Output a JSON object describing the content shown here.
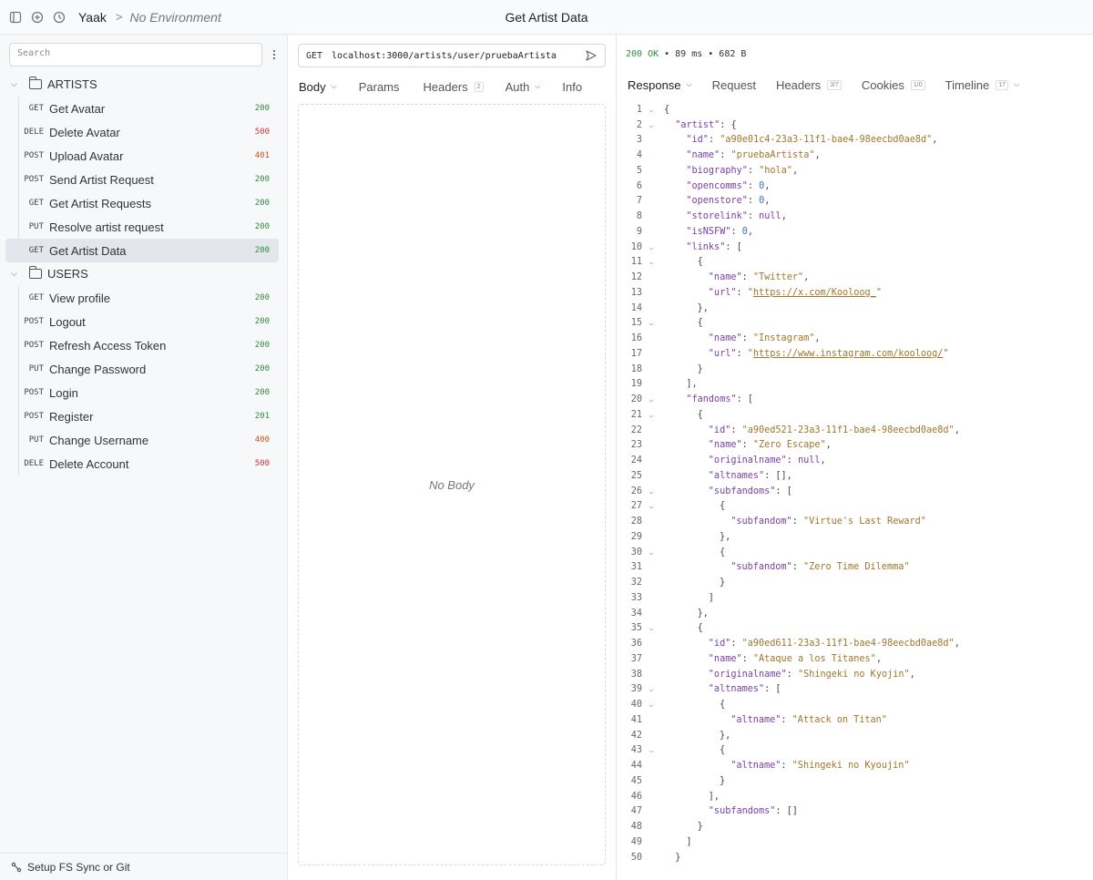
{
  "titlebar": {
    "workspace": "Yaak",
    "separator": ">",
    "environment": "No Environment",
    "window_title": "Get Artist Data"
  },
  "sidebar": {
    "search_placeholder": "Search",
    "folders": [
      {
        "name": "ARTISTS",
        "items": [
          {
            "method": "GET",
            "name": "Get Avatar",
            "status": "200"
          },
          {
            "method": "DELE",
            "name": "Delete Avatar",
            "status": "500"
          },
          {
            "method": "POST",
            "name": "Upload Avatar",
            "status": "401"
          },
          {
            "method": "POST",
            "name": "Send Artist Request",
            "status": "200"
          },
          {
            "method": "GET",
            "name": "Get Artist Requests",
            "status": "200"
          },
          {
            "method": "PUT",
            "name": "Resolve artist request",
            "status": "200"
          },
          {
            "method": "GET",
            "name": "Get Artist Data",
            "status": "200",
            "active": true
          }
        ]
      },
      {
        "name": "USERS",
        "items": [
          {
            "method": "GET",
            "name": "View profile",
            "status": "200"
          },
          {
            "method": "POST",
            "name": "Logout",
            "status": "200"
          },
          {
            "method": "POST",
            "name": "Refresh Access Token",
            "status": "200"
          },
          {
            "method": "PUT",
            "name": "Change Password",
            "status": "200"
          },
          {
            "method": "POST",
            "name": "Login",
            "status": "200"
          },
          {
            "method": "POST",
            "name": "Register",
            "status": "201"
          },
          {
            "method": "PUT",
            "name": "Change Username",
            "status": "400"
          },
          {
            "method": "DELE",
            "name": "Delete Account",
            "status": "500"
          }
        ]
      }
    ],
    "footer": "Setup FS Sync or Git"
  },
  "request": {
    "method": "GET",
    "url": "localhost:3000/artists/user/pruebaArtista",
    "tabs": {
      "body": "Body",
      "params": "Params",
      "headers": "Headers",
      "headers_count": "2",
      "auth": "Auth",
      "info": "Info"
    },
    "empty_body": "No Body"
  },
  "response": {
    "status": "200 OK",
    "time": "89 ms",
    "size": "682 B",
    "bullet": "•",
    "tabs": {
      "response": "Response",
      "request": "Request",
      "headers": "Headers",
      "headers_count": "3/7",
      "cookies": "Cookies",
      "cookies_count": "1/0",
      "timeline": "Timeline",
      "timeline_count": "17"
    },
    "lines": [
      {
        "n": "1",
        "fold": "v",
        "indent": 0,
        "parts": [
          [
            "p",
            "{"
          ]
        ]
      },
      {
        "n": "2",
        "fold": "v",
        "indent": 1,
        "parts": [
          [
            "k",
            "\"artist\""
          ],
          [
            "p",
            ": {"
          ]
        ]
      },
      {
        "n": "3",
        "indent": 2,
        "parts": [
          [
            "k",
            "\"id\""
          ],
          [
            "p",
            ": "
          ],
          [
            "s",
            "\"a90e01c4-23a3-11f1-bae4-98eecbd0ae8d\""
          ],
          [
            "p",
            ","
          ]
        ]
      },
      {
        "n": "4",
        "indent": 2,
        "parts": [
          [
            "k",
            "\"name\""
          ],
          [
            "p",
            ": "
          ],
          [
            "s",
            "\"pruebaArtista\""
          ],
          [
            "p",
            ","
          ]
        ]
      },
      {
        "n": "5",
        "indent": 2,
        "parts": [
          [
            "k",
            "\"biography\""
          ],
          [
            "p",
            ": "
          ],
          [
            "s",
            "\"hola\""
          ],
          [
            "p",
            ","
          ]
        ]
      },
      {
        "n": "6",
        "indent": 2,
        "parts": [
          [
            "k",
            "\"opencomms\""
          ],
          [
            "p",
            ": "
          ],
          [
            "n",
            "0"
          ],
          [
            "p",
            ","
          ]
        ]
      },
      {
        "n": "7",
        "indent": 2,
        "parts": [
          [
            "k",
            "\"openstore\""
          ],
          [
            "p",
            ": "
          ],
          [
            "n",
            "0"
          ],
          [
            "p",
            ","
          ]
        ]
      },
      {
        "n": "8",
        "indent": 2,
        "parts": [
          [
            "k",
            "\"storelink\""
          ],
          [
            "p",
            ": "
          ],
          [
            "k",
            "null"
          ],
          [
            "p",
            ","
          ]
        ]
      },
      {
        "n": "9",
        "indent": 2,
        "parts": [
          [
            "k",
            "\"isNSFW\""
          ],
          [
            "p",
            ": "
          ],
          [
            "n",
            "0"
          ],
          [
            "p",
            ","
          ]
        ]
      },
      {
        "n": "10",
        "fold": "v",
        "indent": 2,
        "parts": [
          [
            "k",
            "\"links\""
          ],
          [
            "p",
            ": ["
          ]
        ]
      },
      {
        "n": "11",
        "fold": "v",
        "indent": 3,
        "parts": [
          [
            "p",
            "{"
          ]
        ]
      },
      {
        "n": "12",
        "indent": 4,
        "parts": [
          [
            "k",
            "\"name\""
          ],
          [
            "p",
            ": "
          ],
          [
            "s",
            "\"Twitter\""
          ],
          [
            "p",
            ","
          ]
        ]
      },
      {
        "n": "13",
        "indent": 4,
        "parts": [
          [
            "k",
            "\"url\""
          ],
          [
            "p",
            ": "
          ],
          [
            "s",
            "\""
          ],
          [
            "u",
            "https://x.com/Kooloog_"
          ],
          [
            "s",
            "\""
          ]
        ]
      },
      {
        "n": "14",
        "indent": 3,
        "parts": [
          [
            "p",
            "},"
          ]
        ]
      },
      {
        "n": "15",
        "fold": "v",
        "indent": 3,
        "parts": [
          [
            "p",
            "{"
          ]
        ]
      },
      {
        "n": "16",
        "indent": 4,
        "parts": [
          [
            "k",
            "\"name\""
          ],
          [
            "p",
            ": "
          ],
          [
            "s",
            "\"Instagram\""
          ],
          [
            "p",
            ","
          ]
        ]
      },
      {
        "n": "17",
        "indent": 4,
        "parts": [
          [
            "k",
            "\"url\""
          ],
          [
            "p",
            ": "
          ],
          [
            "s",
            "\""
          ],
          [
            "u",
            "https://www.instagram.com/kooloog/"
          ],
          [
            "s",
            "\""
          ]
        ]
      },
      {
        "n": "18",
        "indent": 3,
        "parts": [
          [
            "p",
            "}"
          ]
        ]
      },
      {
        "n": "19",
        "indent": 2,
        "parts": [
          [
            "p",
            "],"
          ]
        ]
      },
      {
        "n": "20",
        "fold": "v",
        "indent": 2,
        "parts": [
          [
            "k",
            "\"fandoms\""
          ],
          [
            "p",
            ": ["
          ]
        ]
      },
      {
        "n": "21",
        "fold": "v",
        "indent": 3,
        "parts": [
          [
            "p",
            "{"
          ]
        ]
      },
      {
        "n": "22",
        "indent": 4,
        "parts": [
          [
            "k",
            "\"id\""
          ],
          [
            "p",
            ": "
          ],
          [
            "s",
            "\"a90ed521-23a3-11f1-bae4-98eecbd0ae8d\""
          ],
          [
            "p",
            ","
          ]
        ]
      },
      {
        "n": "23",
        "indent": 4,
        "parts": [
          [
            "k",
            "\"name\""
          ],
          [
            "p",
            ": "
          ],
          [
            "s",
            "\"Zero Escape\""
          ],
          [
            "p",
            ","
          ]
        ]
      },
      {
        "n": "24",
        "indent": 4,
        "parts": [
          [
            "k",
            "\"originalname\""
          ],
          [
            "p",
            ": "
          ],
          [
            "k",
            "null"
          ],
          [
            "p",
            ","
          ]
        ]
      },
      {
        "n": "25",
        "indent": 4,
        "parts": [
          [
            "k",
            "\"altnames\""
          ],
          [
            "p",
            ": [],"
          ]
        ]
      },
      {
        "n": "26",
        "fold": "v",
        "indent": 4,
        "parts": [
          [
            "k",
            "\"subfandoms\""
          ],
          [
            "p",
            ": ["
          ]
        ]
      },
      {
        "n": "27",
        "fold": "v",
        "indent": 5,
        "parts": [
          [
            "p",
            "{"
          ]
        ]
      },
      {
        "n": "28",
        "indent": 6,
        "parts": [
          [
            "k",
            "\"subfandom\""
          ],
          [
            "p",
            ": "
          ],
          [
            "s",
            "\"Virtue's Last Reward\""
          ]
        ]
      },
      {
        "n": "29",
        "indent": 5,
        "parts": [
          [
            "p",
            "},"
          ]
        ]
      },
      {
        "n": "30",
        "fold": "v",
        "indent": 5,
        "parts": [
          [
            "p",
            "{"
          ]
        ]
      },
      {
        "n": "31",
        "indent": 6,
        "parts": [
          [
            "k",
            "\"subfandom\""
          ],
          [
            "p",
            ": "
          ],
          [
            "s",
            "\"Zero Time Dilemma\""
          ]
        ]
      },
      {
        "n": "32",
        "indent": 5,
        "parts": [
          [
            "p",
            "}"
          ]
        ]
      },
      {
        "n": "33",
        "indent": 4,
        "parts": [
          [
            "p",
            "]"
          ]
        ]
      },
      {
        "n": "34",
        "indent": 3,
        "parts": [
          [
            "p",
            "},"
          ]
        ]
      },
      {
        "n": "35",
        "fold": "v",
        "indent": 3,
        "parts": [
          [
            "p",
            "{"
          ]
        ]
      },
      {
        "n": "36",
        "indent": 4,
        "parts": [
          [
            "k",
            "\"id\""
          ],
          [
            "p",
            ": "
          ],
          [
            "s",
            "\"a90ed611-23a3-11f1-bae4-98eecbd0ae8d\""
          ],
          [
            "p",
            ","
          ]
        ]
      },
      {
        "n": "37",
        "indent": 4,
        "parts": [
          [
            "k",
            "\"name\""
          ],
          [
            "p",
            ": "
          ],
          [
            "s",
            "\"Ataque a los Titanes\""
          ],
          [
            "p",
            ","
          ]
        ]
      },
      {
        "n": "38",
        "indent": 4,
        "parts": [
          [
            "k",
            "\"originalname\""
          ],
          [
            "p",
            ": "
          ],
          [
            "s",
            "\"Shingeki no Kyojin\""
          ],
          [
            "p",
            ","
          ]
        ]
      },
      {
        "n": "39",
        "fold": "v",
        "indent": 4,
        "parts": [
          [
            "k",
            "\"altnames\""
          ],
          [
            "p",
            ": ["
          ]
        ]
      },
      {
        "n": "40",
        "fold": "v",
        "indent": 5,
        "parts": [
          [
            "p",
            "{"
          ]
        ]
      },
      {
        "n": "41",
        "indent": 6,
        "parts": [
          [
            "k",
            "\"altname\""
          ],
          [
            "p",
            ": "
          ],
          [
            "s",
            "\"Attack on Titan\""
          ]
        ]
      },
      {
        "n": "42",
        "indent": 5,
        "parts": [
          [
            "p",
            "},"
          ]
        ]
      },
      {
        "n": "43",
        "fold": "v",
        "indent": 5,
        "parts": [
          [
            "p",
            "{"
          ]
        ]
      },
      {
        "n": "44",
        "indent": 6,
        "parts": [
          [
            "k",
            "\"altname\""
          ],
          [
            "p",
            ": "
          ],
          [
            "s",
            "\"Shingeki no Kyoujin\""
          ]
        ]
      },
      {
        "n": "45",
        "indent": 5,
        "parts": [
          [
            "p",
            "}"
          ]
        ]
      },
      {
        "n": "46",
        "indent": 4,
        "parts": [
          [
            "p",
            "],"
          ]
        ]
      },
      {
        "n": "47",
        "indent": 4,
        "parts": [
          [
            "k",
            "\"subfandoms\""
          ],
          [
            "p",
            ": []"
          ]
        ]
      },
      {
        "n": "48",
        "indent": 3,
        "parts": [
          [
            "p",
            "}"
          ]
        ]
      },
      {
        "n": "49",
        "indent": 2,
        "parts": [
          [
            "p",
            "]"
          ]
        ]
      },
      {
        "n": "50",
        "indent": 1,
        "parts": [
          [
            "p",
            "}"
          ]
        ]
      }
    ]
  },
  "colors": {
    "accent_green": "#2f8a3d",
    "status_4xx": "#c8541d",
    "status_5xx": "#d12f3f",
    "json_key": "#7a3fa3",
    "json_string": "#a0762a",
    "json_number": "#3870c2"
  }
}
